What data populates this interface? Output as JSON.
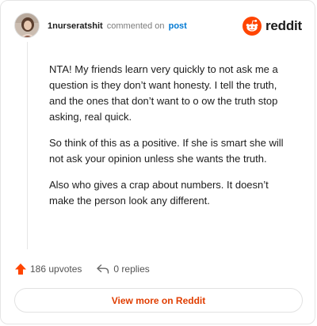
{
  "comment": {
    "username": "1nurseratshit",
    "action": "commented on",
    "post_link": "post",
    "paragraphs": [
      "NTA! My friends learn very quickly to not ask me a question is they don’t want honesty. I tell the truth, and the ones that don’t want to o ow the truth stop asking, real quick.",
      "So think of this as a positive. If she is smart she will not ask your opinion unless she wants the truth.",
      "Also who gives a crap about numbers. It doesn’t make the person look any different."
    ],
    "upvotes_label": "186 upvotes",
    "replies_label": "0 replies"
  },
  "brand": {
    "wordmark": "reddit",
    "color": "#ff4500"
  },
  "view_more_label": "View more on Reddit",
  "colors": {
    "accent": "#ff4500",
    "link": "#0079d3",
    "view_more": "#e03d00"
  }
}
